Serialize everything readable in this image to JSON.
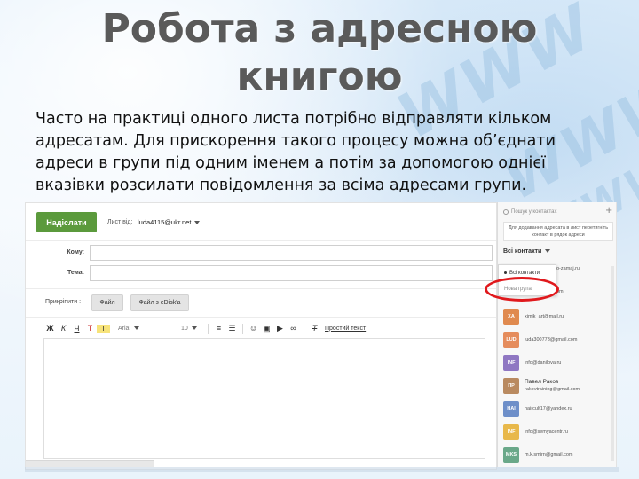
{
  "title": "Робота з адресною книгою",
  "description": "Часто на практиці одного листа потрібно відправляти кільком адресатам. Для прискорення такого процесу можна об’єднати адреси в групи під одним іменем а потім за допомогою однієї вказівки розсилати повідомлення за всіма адресами групи.",
  "background": {
    "watermark": "WWW"
  },
  "composer": {
    "send_label": "Надіслати",
    "from_label": "Лист від:",
    "from_value": "luda4115@ukr.net",
    "to_label": "Кому:",
    "subject_label": "Тема:",
    "attach_label": "Прикріпити :",
    "file_button": "Файл",
    "edisk_button": "Файл з eDisk'a",
    "toolbar": {
      "bold": "Ж",
      "italic": "К",
      "underline": "Ч",
      "text_color": "Т",
      "highlight": "Т",
      "font": "Arial",
      "size": "10",
      "plain_text": "Простий текст"
    }
  },
  "contacts": {
    "search_placeholder": "Пошук у контактах",
    "add_symbol": "+",
    "hint": "Для додавання адресата в лист перетягніть контакт в рядок адреси",
    "group_selector": "Всі контакти",
    "dropdown": {
      "all_contacts": "Всі контакти",
      "new_group": "Нова група"
    },
    "partial_emails": [
      "o-zamaj.ru",
      "om"
    ],
    "items": [
      {
        "initials": "ХА",
        "email": "ximik_art@mail.ru",
        "color": "#e08a4f"
      },
      {
        "initials": "LUD",
        "email": "luda300773@gmail.com",
        "color": "#e58c5c"
      },
      {
        "initials": "INF",
        "email": "info@danilova.ru",
        "color": "#8f77c2"
      },
      {
        "initials": "ПР",
        "name": "Павел Раков",
        "email": "rakovtraining@gmail.com",
        "color": "#b98a60"
      },
      {
        "initials": "HAI",
        "email": "haircult17@yandex.ru",
        "color": "#6e8fc9"
      },
      {
        "initials": "INF",
        "email": "info@semyacentr.ru",
        "color": "#e8b84a"
      },
      {
        "initials": "MKS",
        "email": "m.k.smirn@gmail.com",
        "color": "#6aa889"
      }
    ]
  },
  "colors": {
    "send_button": "#5b9a3c",
    "highlight_marker": "#e0191d",
    "title": "#5a5a5a"
  }
}
